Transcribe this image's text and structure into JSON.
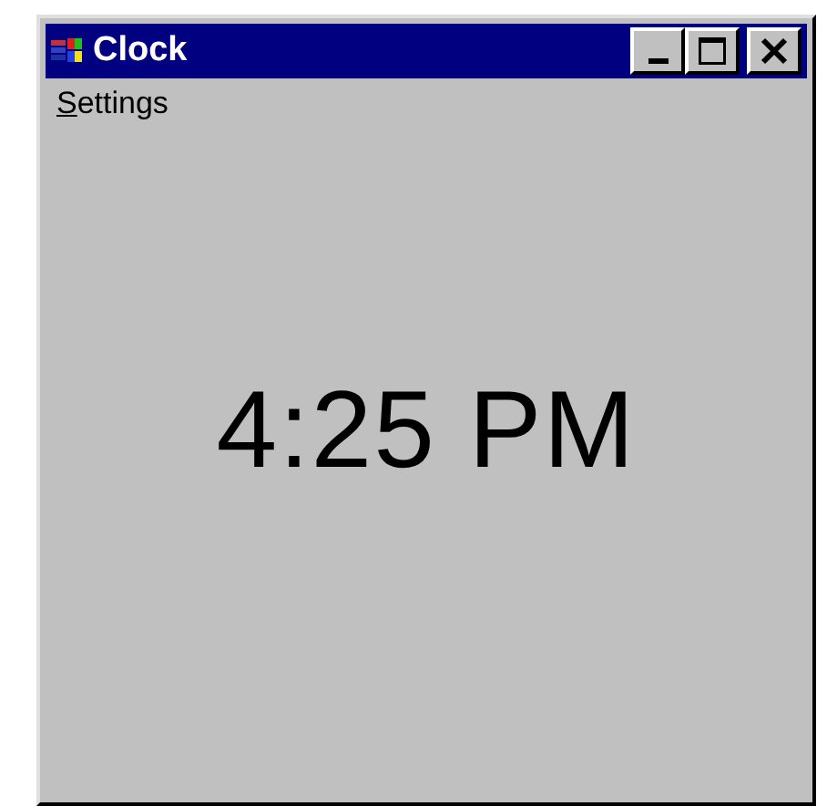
{
  "window": {
    "title": "Clock"
  },
  "menu": [
    {
      "label": "Settings"
    }
  ],
  "clock": {
    "time": "4:25 PM"
  }
}
